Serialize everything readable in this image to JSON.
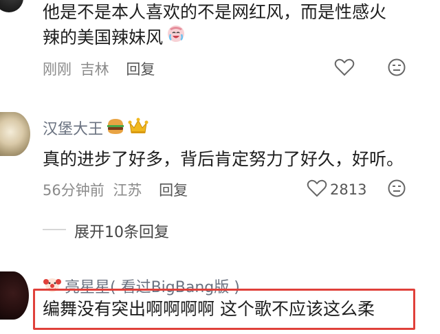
{
  "comments": [
    {
      "text_line1": "他是不是本人喜欢的不是网红风，而是性感火",
      "text_line2": "辣的美国辣妹风",
      "emoji": "laughing-crying-emoji",
      "time": "刚刚",
      "location": "吉林",
      "reply_label": "回复",
      "like_icon": "heart-outline-icon",
      "more_icon": "emoji-reaction-icon"
    },
    {
      "username": "汉堡大王",
      "badges": [
        "hamburger-emoji",
        "crown-emoji"
      ],
      "text": "真的进步了好多，背后肯定努力了好久，好听。",
      "time": "56分钟前",
      "location": "江苏",
      "reply_label": "回复",
      "like_count": "2813",
      "like_icon": "heart-outline-icon",
      "more_icon": "emoji-reaction-icon",
      "expand_replies": "展开10条回复"
    },
    {
      "username": "亮星星( 看过BigBang版 )",
      "badge": "clown-emoji",
      "text": "编舞没有突出啊啊啊啊 这个歌不应该这么柔"
    }
  ],
  "colors": {
    "highlight_border": "#e0403a",
    "meta_text": "#8a8a8a",
    "username_text": "#6a7280"
  }
}
